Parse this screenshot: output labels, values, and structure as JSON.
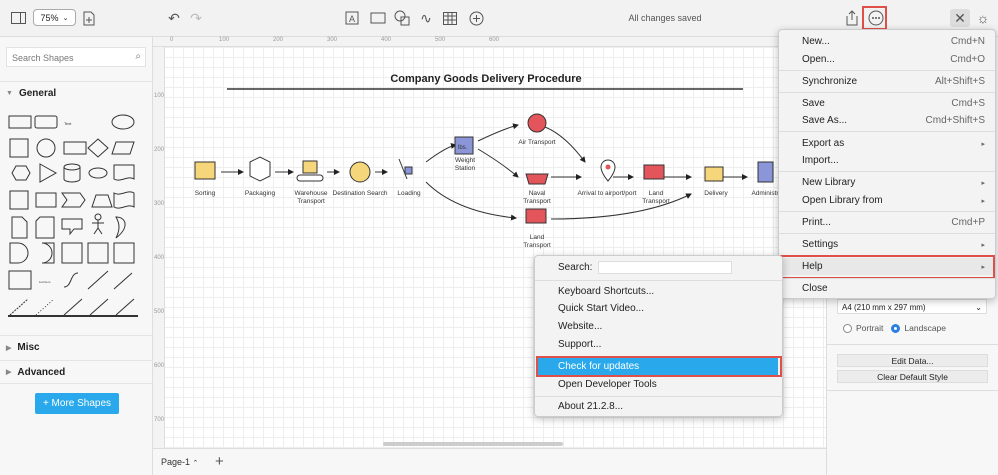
{
  "toolbar": {
    "zoom": "75%",
    "status": "All changes saved"
  },
  "sidebar": {
    "search_placeholder": "Search Shapes",
    "sections": [
      "General",
      "Misc",
      "Advanced"
    ],
    "more_shapes": "+ More Shapes"
  },
  "rulers": {
    "top": [
      "0",
      "100",
      "200",
      "300",
      "400",
      "500",
      "600"
    ],
    "left": [
      "100",
      "200",
      "300",
      "400",
      "500",
      "600",
      "700"
    ]
  },
  "diagram": {
    "title": "Company Goods Delivery Procedure",
    "nodes": [
      "Sorting",
      "Packaging",
      "Warehouse Transport",
      "Destination Search",
      "Loading",
      "Weight Station",
      "Air Transport",
      "Naval Transport",
      "Land Transport",
      "Arrival to airport/port",
      "Land Transport",
      "Delivery",
      "Administr"
    ],
    "weight_icon_text": "lbs."
  },
  "page_tab": "Page-1",
  "right_panel": {
    "paper_size": "A4 (210 mm x 297 mm)",
    "portrait": "Portrait",
    "landscape": "Landscape",
    "orientation": "Landscape",
    "edit_data": "Edit Data...",
    "clear_style": "Clear Default Style"
  },
  "main_menu": [
    {
      "label": "New...",
      "shortcut": "Cmd+N"
    },
    {
      "label": "Open...",
      "shortcut": "Cmd+O"
    },
    {
      "label": "Synchronize",
      "shortcut": "Alt+Shift+S"
    },
    {
      "label": "Save",
      "shortcut": "Cmd+S"
    },
    {
      "label": "Save As...",
      "shortcut": "Cmd+Shift+S"
    },
    {
      "label": "Export as",
      "shortcut": "▸"
    },
    {
      "label": "Import...",
      "shortcut": ""
    },
    {
      "label": "New Library",
      "shortcut": "▸"
    },
    {
      "label": "Open Library from",
      "shortcut": "▸"
    },
    {
      "label": "Print...",
      "shortcut": "Cmd+P"
    },
    {
      "label": "Settings",
      "shortcut": "▸"
    },
    {
      "label": "Help",
      "shortcut": "▸"
    },
    {
      "label": "Close",
      "shortcut": ""
    }
  ],
  "help_menu": {
    "search_label": "Search:",
    "search_value": "",
    "items": [
      "Keyboard Shortcuts...",
      "Quick Start Video...",
      "Website...",
      "Support...",
      "Check for updates",
      "Open Developer Tools",
      "About 21.2.8..."
    ]
  },
  "colors": {
    "highlight": "#29a9eb",
    "callout": "#e0504a",
    "accent_button": "#29a9eb"
  }
}
